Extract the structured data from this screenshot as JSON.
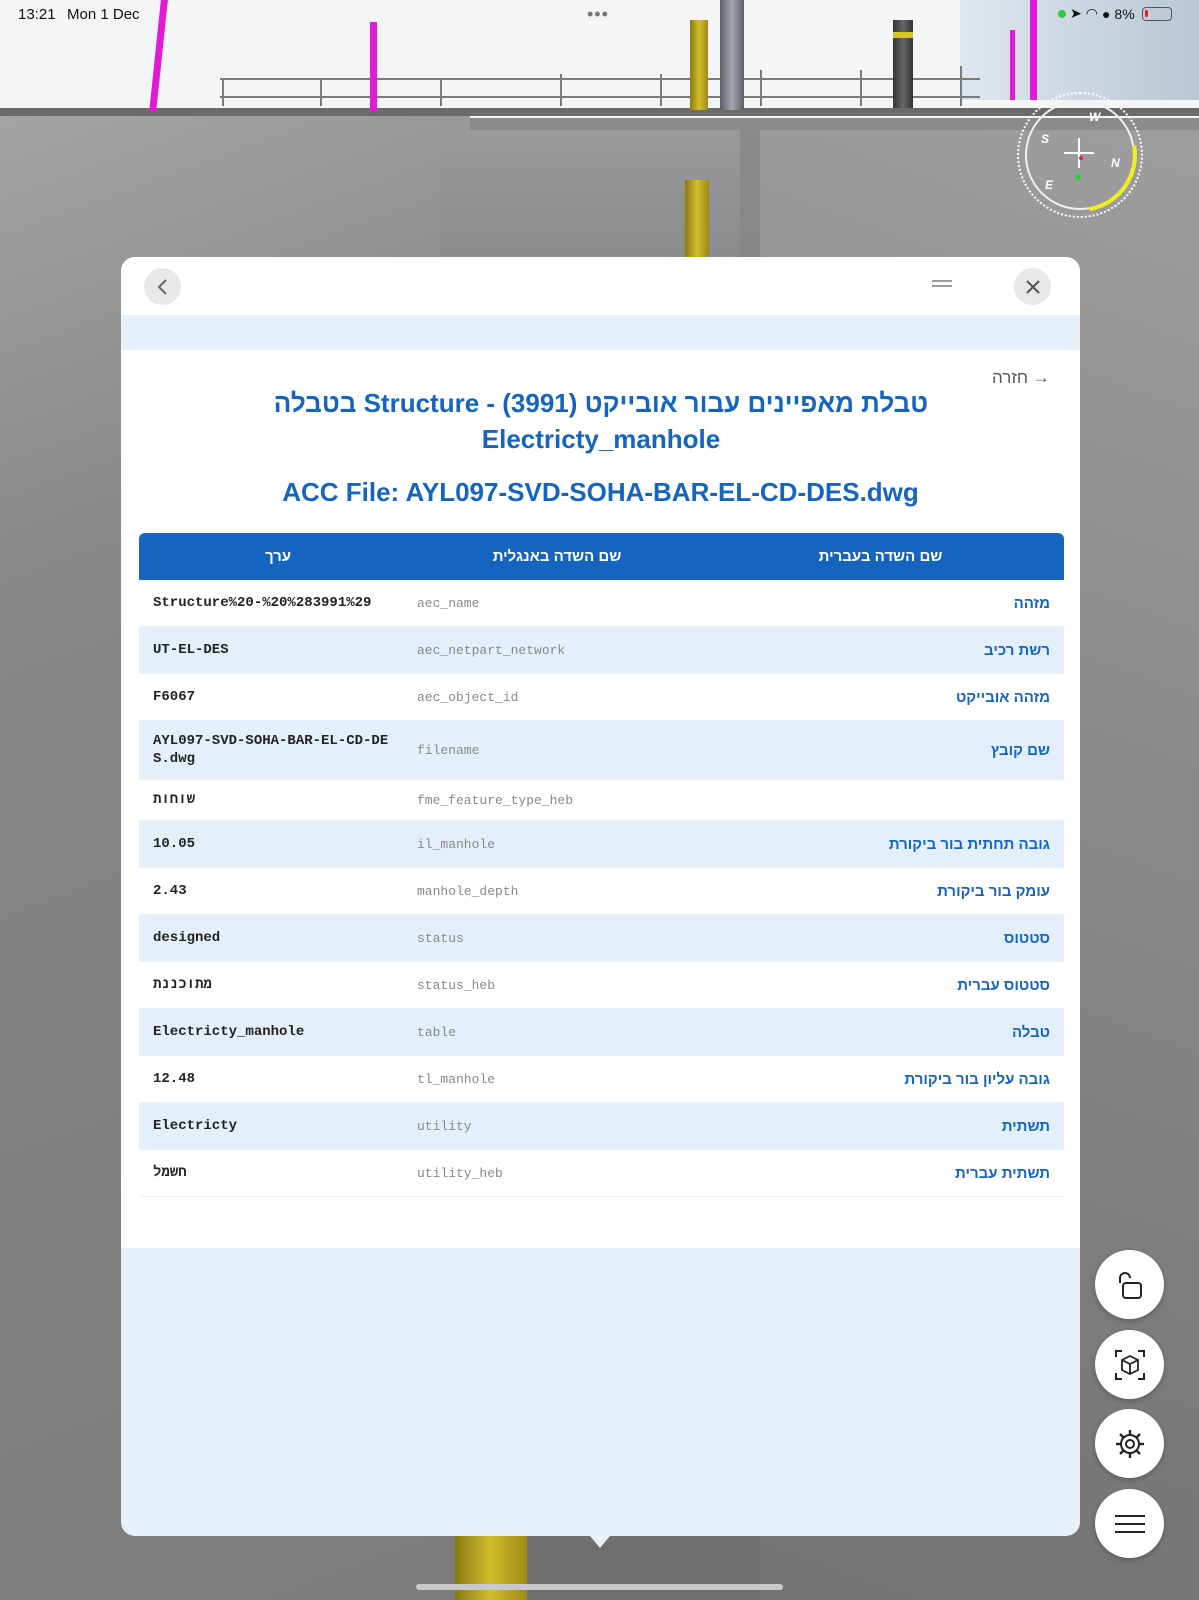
{
  "status_bar": {
    "time": "13:21",
    "date": "Mon 1 Dec",
    "battery": "8%"
  },
  "compass": {
    "labels": {
      "w": "W",
      "s": "S",
      "n": "N",
      "e": "E"
    }
  },
  "modal": {
    "back_link": "→ חזרה",
    "title": "טבלת מאפיינים עבור אובייקט Structure - (3991) בטבלה Electricty_manhole",
    "subtitle": "ACC File: AYL097-SVD-SOHA-BAR-EL-CD-DES.dwg",
    "table": {
      "headers": {
        "value": "ערך",
        "english_field": "שם השדה באנגלית",
        "hebrew_field": "שם השדה בעברית"
      },
      "rows": [
        {
          "value": "Structure%20-%20%283991%29",
          "english": "aec_name",
          "hebrew": "מזהה"
        },
        {
          "value": "UT-EL-DES",
          "english": "aec_netpart_network",
          "hebrew": "רשת רכיב"
        },
        {
          "value": "F6067",
          "english": "aec_object_id",
          "hebrew": "מזהה אובייקט"
        },
        {
          "value": "AYL097-SVD-SOHA-BAR-EL-CD-DES.dwg",
          "english": "filename",
          "hebrew": "שם קובץ"
        },
        {
          "value": "שוחות",
          "english": "fme_feature_type_heb",
          "hebrew": ""
        },
        {
          "value": "10.05",
          "english": "il_manhole",
          "hebrew": "גובה תחתית בור ביקורת"
        },
        {
          "value": "2.43",
          "english": "manhole_depth",
          "hebrew": "עומק בור ביקורת"
        },
        {
          "value": "designed",
          "english": "status",
          "hebrew": "סטטוס"
        },
        {
          "value": "מתוכננת",
          "english": "status_heb",
          "hebrew": "סטטוס עברית"
        },
        {
          "value": "Electricty_manhole",
          "english": "table",
          "hebrew": "טבלה"
        },
        {
          "value": "12.48",
          "english": "tl_manhole",
          "hebrew": "גובה עליון בור ביקורת"
        },
        {
          "value": "Electricty",
          "english": "utility",
          "hebrew": "תשתית"
        },
        {
          "value": "חשמל",
          "english": "utility_heb",
          "hebrew": "תשתית עברית"
        }
      ]
    }
  },
  "icons": {
    "back": "chevron-left-icon",
    "close": "close-icon",
    "grip": "drag-handle-icon",
    "lock": "unlock-icon",
    "cube": "cube-scan-icon",
    "settings": "gear-icon",
    "menu": "hamburger-menu-icon"
  }
}
